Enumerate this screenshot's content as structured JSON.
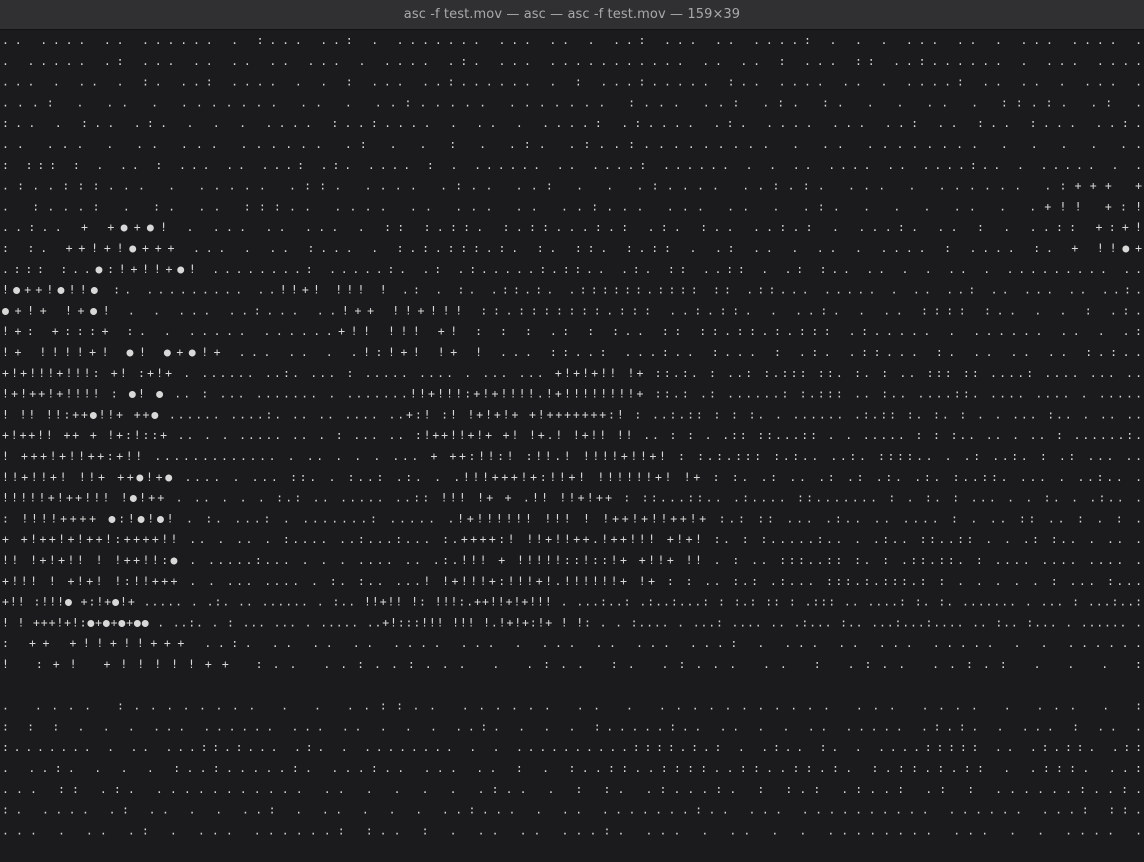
{
  "window": {
    "title": "asc -f test.mov — asc — asc -f test.mov — 159×39"
  },
  "terminal": {
    "columns": 159,
    "rows": 39,
    "background_color": "#1b1a1c",
    "foreground_color": "#d8d8d8",
    "content": "ascii-video-frame"
  }
}
